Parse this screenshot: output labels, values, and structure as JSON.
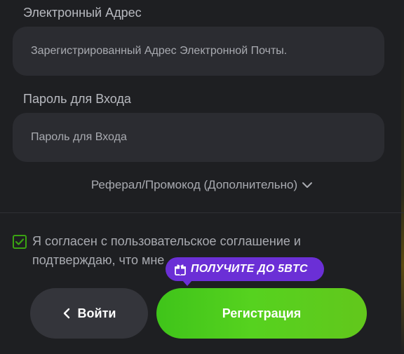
{
  "email": {
    "label": "Электронный Адрес",
    "placeholder": "Зарегистрированный Адрес Электронной Почты.",
    "value": ""
  },
  "password": {
    "label": "Пароль для Входа",
    "placeholder": "Пароль для Входа",
    "value": ""
  },
  "referral": {
    "label": "Реферал/Промокод (Дополнительно)",
    "icon": "chevron-down-icon"
  },
  "agreement": {
    "checked": true,
    "text": "Я согласен с пользовательское соглашение и подтверждаю, что мне"
  },
  "promo": {
    "icon": "gift-icon",
    "text": "ПОЛУЧИТЕ ДО 5BTC"
  },
  "buttons": {
    "login_label": "Войти",
    "register_label": "Регистрация"
  },
  "colors": {
    "accent_green": "#56d21f",
    "promo_purple": "#6b2fd6",
    "background": "#1e1f22"
  }
}
